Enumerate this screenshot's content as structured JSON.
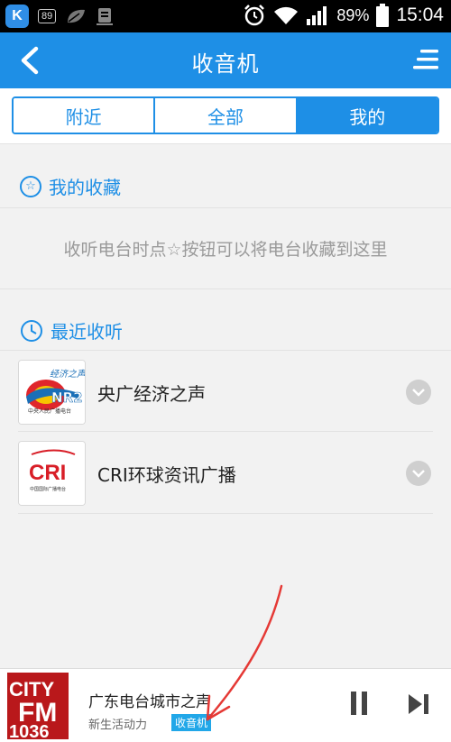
{
  "status_bar": {
    "app_badge": "K",
    "notification_count": "89",
    "battery": "89%",
    "time": "15:04",
    "icons": [
      "leaf-icon",
      "download-icon",
      "alarm-icon",
      "wifi-icon",
      "signal-icon",
      "battery-icon"
    ]
  },
  "header": {
    "title": "收音机",
    "back_icon": "chevron-left-icon",
    "menu_icon": "menu-icon"
  },
  "tabs": [
    {
      "label": "附近",
      "active": false
    },
    {
      "label": "全部",
      "active": false
    },
    {
      "label": "我的",
      "active": true
    }
  ],
  "favorites": {
    "heading": "我的收藏",
    "icon": "star-icon",
    "empty_hint": "收听电台时点☆按钮可以将电台收藏到这里"
  },
  "recent": {
    "heading": "最近收听",
    "icon": "clock-icon",
    "stations": [
      {
        "name": "央广经济之声",
        "logo_text_top": "经济之声",
        "logo_text_bottom": "中央人民广播电台"
      },
      {
        "name": "CRI环球资讯广播",
        "logo_text": "CRI",
        "logo_text_bottom": "中国国际广播电台"
      }
    ]
  },
  "player": {
    "station": "广东电台城市之声",
    "subtitle": "新生活动力",
    "badge": "收音机",
    "logo_text_1": "CITY",
    "logo_text_2": "FM",
    "logo_text_3": "1036"
  },
  "colors": {
    "primary": "#1e8fe6",
    "status_bar": "#000000",
    "background": "#f2f2f2",
    "badge": "#21a7e8",
    "annotation": "#e53935"
  }
}
